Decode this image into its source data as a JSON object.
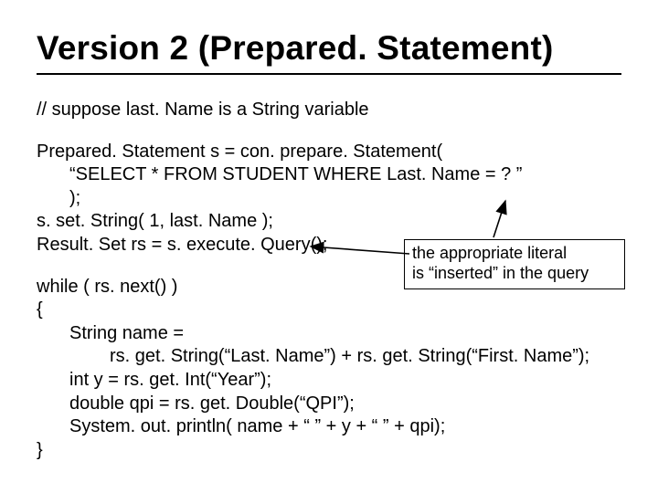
{
  "title": "Version 2 (Prepared. Statement)",
  "comment": "// suppose last. Name is a String variable",
  "code1": {
    "l1": "Prepared. Statement s = con. prepare. Statement(",
    "l2": "“SELECT * FROM STUDENT WHERE Last. Name = ? ”",
    "l3": ");",
    "l4": "s. set. String( 1, last. Name );",
    "l5": "Result. Set rs = s. execute. Query();"
  },
  "callout": {
    "line1": "the appropriate literal",
    "line2": "is “inserted” in the query"
  },
  "code2": {
    "l1": "while ( rs. next() )",
    "l2": "{",
    "l3": "String name =",
    "l4": "rs. get. String(“Last. Name”) + rs. get. String(“First. Name”);",
    "l5": "int y = rs. get. Int(“Year”);",
    "l6": "double qpi = rs. get. Double(“QPI”);",
    "l7": "System. out. println( name + “ ” + y + “ ” + qpi);",
    "l8": "}"
  }
}
